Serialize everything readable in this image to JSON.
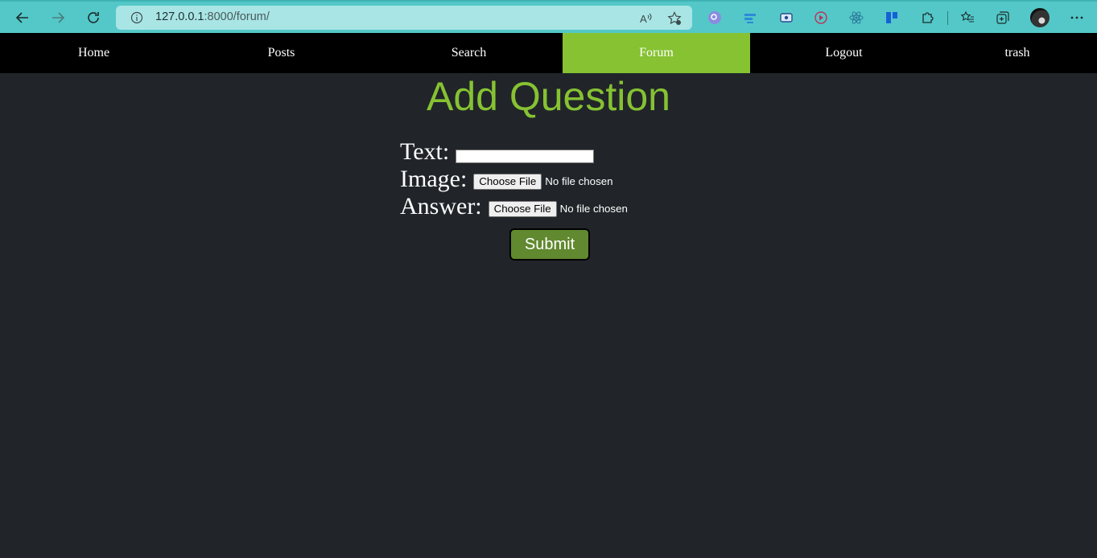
{
  "browser": {
    "url_host": "127.0.0.1",
    "url_rest": ":8000/forum/"
  },
  "nav": {
    "items": [
      {
        "label": "Home",
        "active": false
      },
      {
        "label": "Posts",
        "active": false
      },
      {
        "label": "Search",
        "active": false
      },
      {
        "label": "Forum",
        "active": true
      },
      {
        "label": "Logout",
        "active": false
      },
      {
        "label": "trash",
        "active": false
      }
    ]
  },
  "page": {
    "title": "Add Question"
  },
  "form": {
    "text_label": "Text:",
    "text_value": "",
    "image_label": "Image:",
    "answer_label": "Answer:",
    "choose_file_label": "Choose File",
    "no_file_text": "No file chosen",
    "submit_label": "Submit"
  },
  "colors": {
    "accent": "#86c232",
    "submit_bg": "#61892f",
    "background": "#212529",
    "chrome": "#54c8c8"
  }
}
